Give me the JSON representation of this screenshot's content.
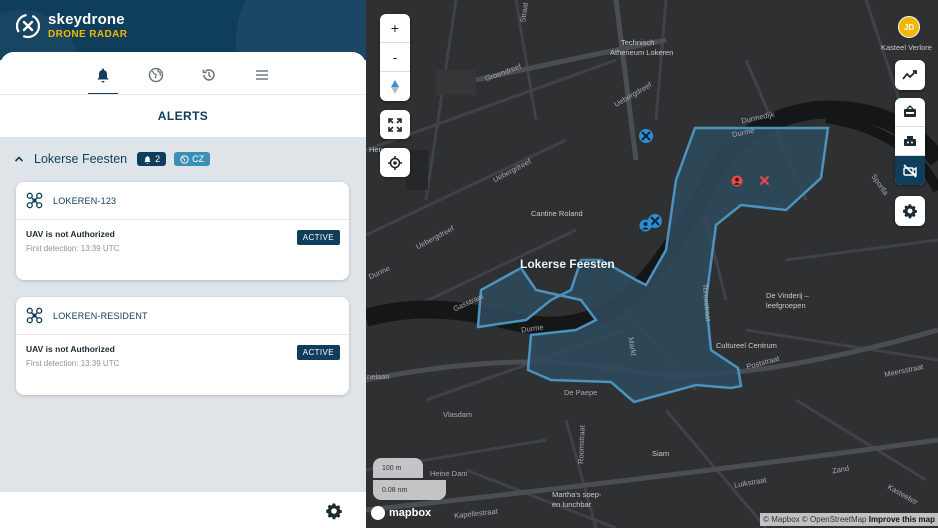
{
  "brand": {
    "name": "skeydrone",
    "product": "DRONE RADAR"
  },
  "tabs": [
    {
      "id": "alerts",
      "icon": "bell-icon"
    },
    {
      "id": "airspace",
      "icon": "globe-icon"
    },
    {
      "id": "history",
      "icon": "history-icon"
    },
    {
      "id": "menu",
      "icon": "menu-icon"
    }
  ],
  "section": {
    "title": "ALERTS"
  },
  "group": {
    "name": "Lokerse Feesten",
    "alert_count": "2",
    "region": "CZ"
  },
  "alerts": [
    {
      "drone_id": "LOKEREN-123",
      "message": "UAV is not Authorized",
      "detection": "First detection: 13:39 UTC",
      "status": "ACTIVE"
    },
    {
      "drone_id": "LOKEREN-RESIDENT",
      "message": "UAV is not Authorized",
      "detection": "First detection: 13:39 UTC",
      "status": "ACTIVE"
    }
  ],
  "map": {
    "zoom_in": "+",
    "zoom_out": "-",
    "zone_label": "Lokerse Feesten",
    "user_initials": "JD",
    "scale_metric": "100 m",
    "scale_nautical": "0.08 nm",
    "provider": "mapbox",
    "attribution_prefix": "© Mapbox © OpenStreetMap",
    "attribution_link": "Improve this map",
    "labels": {
      "technisch": "Technisch",
      "atheneum": "Atheneum Lokeren",
      "kasteel": "Kasteel Verlore",
      "cantine": "Cantine Roland",
      "vinderij": "De Vinderij –",
      "leefgroepen": "leefgroepen",
      "cultureel": "Cultureel Centrum",
      "siam": "Siam",
      "marthas": "Martha's soep-",
      "marthas2": "en lunchbar",
      "hen": "Hen"
    },
    "streets": {
      "greendreef": "Groendreef",
      "uebergdreef": "Uebergdreef",
      "uebergdreef2": "Uebergdreef",
      "uebergdreef3": "Uebergdreef",
      "durmedijk": "Durmedijk",
      "durme1": "Durme",
      "durme2": "Durme",
      "durme3": "Durme",
      "gasstraat": "Gasstraat",
      "markt": "Markt",
      "roomstraat": "Roomstraat",
      "vlasdam": "Vlasdam",
      "depaepe": "De Paepe",
      "poststraat": "Poststraat",
      "meersstraat": "Meersstraat",
      "luikstraat": "Luikstraat",
      "zand": "Zand",
      "kapellestraat": "Kapellestraat",
      "sportlaan": "Sportla",
      "heine": "Heine Dam",
      "nelaan": "nelaan",
      "torenstraat": "Torenstraat",
      "strasse": "Straat",
      "kasteel2": "Kasteelstr"
    }
  },
  "colors": {
    "brand_navy": "#0f3e5c",
    "brand_yellow": "#f2b705",
    "zone_fill": "#2f4a5c",
    "zone_stroke": "#4c93bf",
    "drone_blue": "#2c8fd6",
    "drone_red": "#e84a4a"
  }
}
